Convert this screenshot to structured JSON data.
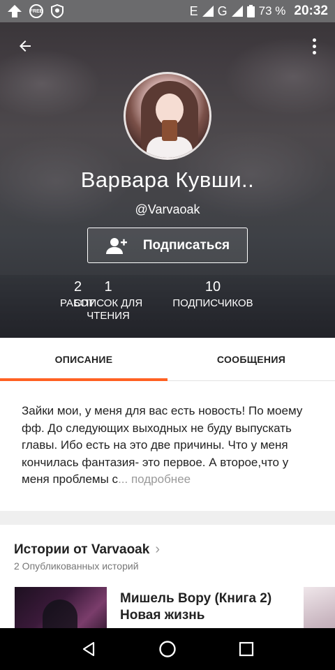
{
  "status_bar": {
    "network_left": "E",
    "network_right": "G",
    "battery": "73 %",
    "time": "20:32",
    "notification_icons": [
      "upload-icon",
      "free-badge-icon",
      "shield-icon"
    ]
  },
  "header": {
    "name": "Варвара Кувши..",
    "handle": "@Varvaoak",
    "follow_label": "Подписаться",
    "stats": [
      {
        "value": "2",
        "label": "РАБОТ"
      },
      {
        "value": "1",
        "label": "СПИСОК ДЛЯ ЧТЕНИЯ"
      },
      {
        "value": "10",
        "label": "ПОДПИСЧИКОВ"
      }
    ]
  },
  "tabs": [
    {
      "label": "ОПИСАНИЕ",
      "active": true
    },
    {
      "label": "СООБЩЕНИЯ",
      "active": false
    }
  ],
  "description": {
    "text": "Зайки мои, у меня для вас есть новость! По моему фф. До следующих выходных не буду выпускать главы. Ибо есть на это две причины. Что у меня кончилась фантазия- это первое. А второе,что у меня проблемы с",
    "more_label": "... подробнее"
  },
  "stories": {
    "title": "Истории от Varvaoak",
    "subtitle": "2 Опубликованных историй",
    "items": [
      {
        "title": "Мишель Вору (Книга 2) Новая жизнь"
      }
    ]
  },
  "colors": {
    "accent": "#ff6122",
    "text": "#222222",
    "muted": "#9a9a9a"
  }
}
